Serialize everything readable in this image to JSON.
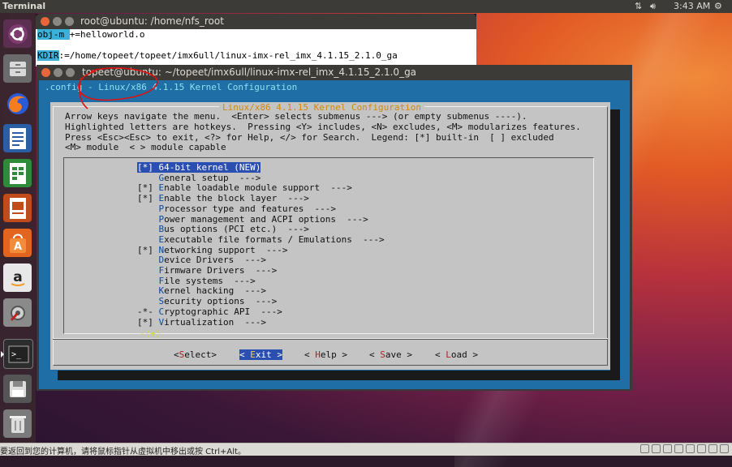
{
  "top_panel": {
    "app_title": "Terminal",
    "clock": "3:43 AM",
    "network_icon": "network-arrows-icon",
    "volume_icon": "volume-icon",
    "settings_icon": "gear-icon"
  },
  "launcher": {
    "items": [
      {
        "name": "ubuntu-dash",
        "icon": "ubuntu-logo-icon"
      },
      {
        "name": "files",
        "icon": "file-cabinet-icon"
      },
      {
        "name": "firefox",
        "icon": "firefox-icon"
      },
      {
        "name": "writer",
        "icon": "document-icon"
      },
      {
        "name": "calc",
        "icon": "spreadsheet-icon"
      },
      {
        "name": "impress",
        "icon": "presentation-icon"
      },
      {
        "name": "software",
        "icon": "shopping-bag-icon"
      },
      {
        "name": "amazon",
        "icon": "amazon-icon"
      },
      {
        "name": "settings",
        "icon": "settings-wrench-icon"
      },
      {
        "name": "terminal",
        "icon": "terminal-icon"
      },
      {
        "name": "save",
        "icon": "floppy-disk-icon"
      },
      {
        "name": "trash",
        "icon": "trash-icon"
      }
    ]
  },
  "back_terminal": {
    "title": "root@ubuntu: /home/nfs_root",
    "lines": [
      {
        "highlight": "obj-m ",
        "rest": "+=helloworld.o"
      },
      {
        "highlight": "",
        "rest": ""
      },
      {
        "highlight": "KDIR",
        "rest": ":=/home/topeet/topeet/imx6ull/linux-imx-rel_imx_4.1.15_2.1.0_ga"
      }
    ]
  },
  "main_terminal": {
    "title": "topeet@ubuntu: ~/topeet/imx6ull/linux-imx-rel_imx_4.1.15_2.1.0_ga",
    "config_line_prefix": ".config - ",
    "config_line_main": "Linux/x86 4.1.15 Kernel Configuration",
    "dialog_title": "Linux/x86 4.1.15 Kernel Configuration",
    "help_text": [
      "Arrow keys navigate the menu.  <Enter> selects submenus ---> (or empty submenus ----).",
      "Highlighted letters are hotkeys.  Pressing <Y> includes, <N> excludes, <M> modularizes features.",
      "Press <Esc><Esc> to exit, <?> for Help, </> for Search.  Legend: [*] built-in  [ ] excluded",
      "<M> module  < > module capable"
    ],
    "menu_items": [
      {
        "prefix": "[*] ",
        "hotkey": "6",
        "text": "4-bit kernel (NEW)",
        "selected": true
      },
      {
        "prefix": "    ",
        "hotkey": "G",
        "text": "eneral setup  --->",
        "selected": false
      },
      {
        "prefix": "[*] ",
        "hotkey": "E",
        "text": "nable loadable module support  --->",
        "selected": false
      },
      {
        "prefix": "[*] ",
        "hotkey": "E",
        "text": "nable the block layer  --->",
        "selected": false
      },
      {
        "prefix": "    ",
        "hotkey": "P",
        "text": "rocessor type and features  --->",
        "selected": false
      },
      {
        "prefix": "    ",
        "hotkey": "P",
        "text": "ower management and ACPI options  --->",
        "selected": false
      },
      {
        "prefix": "    ",
        "hotkey": "B",
        "text": "us options (PCI etc.)  --->",
        "selected": false
      },
      {
        "prefix": "    ",
        "hotkey": "E",
        "text": "xecutable file formats / Emulations  --->",
        "selected": false
      },
      {
        "prefix": "[*] ",
        "hotkey": "N",
        "text": "etworking support  --->",
        "selected": false
      },
      {
        "prefix": "    ",
        "hotkey": "D",
        "text": "evice Drivers  --->",
        "selected": false
      },
      {
        "prefix": "    ",
        "hotkey": "F",
        "text": "irmware Drivers  --->",
        "selected": false
      },
      {
        "prefix": "    ",
        "hotkey": "F",
        "text": "ile systems  --->",
        "selected": false
      },
      {
        "prefix": "    ",
        "hotkey": "K",
        "text": "ernel hacking  --->",
        "selected": false
      },
      {
        "prefix": "    ",
        "hotkey": "S",
        "text": "ecurity options  --->",
        "selected": false
      },
      {
        "prefix": "-*- ",
        "hotkey": "C",
        "text": "ryptographic API  --->",
        "selected": false
      },
      {
        "prefix": "[*] ",
        "hotkey": "V",
        "text": "irtualization  --->",
        "selected": false
      }
    ],
    "more_indicator": "-(+)",
    "buttons": [
      {
        "open": "<",
        "hotkey": "S",
        "rest": "elect>",
        "selected": false
      },
      {
        "open": "< ",
        "hotkey": "E",
        "rest": "xit >",
        "selected": true
      },
      {
        "open": "< ",
        "hotkey": "H",
        "rest": "elp >",
        "selected": false
      },
      {
        "open": "< ",
        "hotkey": "S",
        "rest": "ave >",
        "selected": false
      },
      {
        "open": "< ",
        "hotkey": "L",
        "rest": "oad >",
        "selected": false
      }
    ]
  },
  "status_bar": {
    "message": "要返回到您的计算机，请将鼠标指针从虚拟机中移出或按 Ctrl+Alt。"
  },
  "colors": {
    "annotation": "#e01010",
    "menu_blue": "#1f6ea5",
    "dialog_grey": "#c4c4c4",
    "selection": "#2a4fb0"
  }
}
